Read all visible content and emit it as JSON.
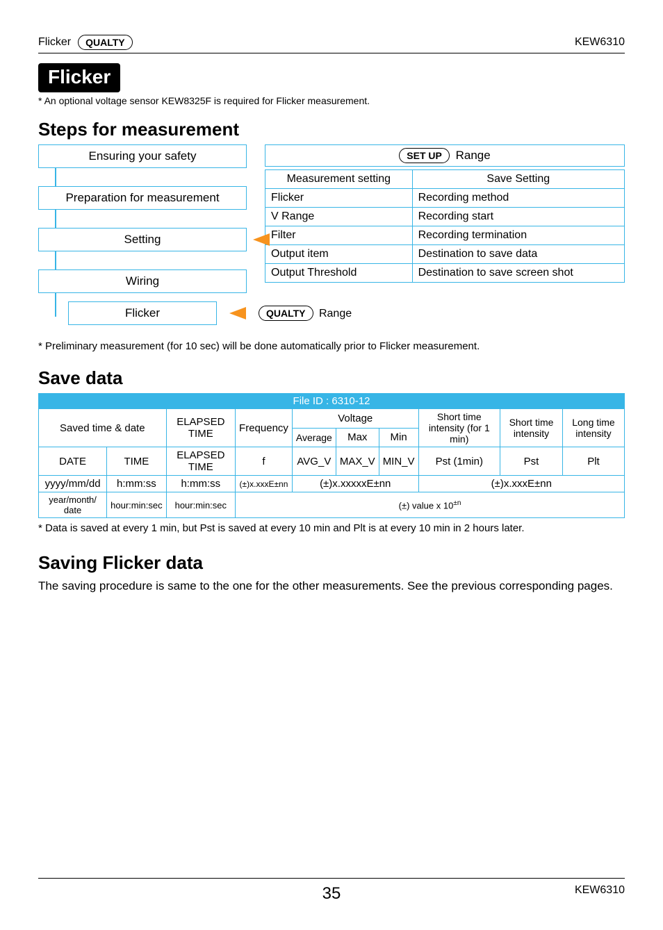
{
  "header": {
    "left_label": "Flicker",
    "left_pill": "QUALTY",
    "right_label": "KEW6310"
  },
  "flicker_chip": "Flicker",
  "sensor_note": "* An optional voltage sensor KEW8325F is required for Flicker measurement.",
  "steps_heading": "Steps for measurement",
  "steps": {
    "s1": "Ensuring your safety",
    "s2": "Preparation for measurement",
    "s3": "Setting",
    "s4": "Wiring",
    "s5": "Flicker"
  },
  "range": {
    "pill": "SET UP",
    "range_text": "Range",
    "col1_head": "Measurement setting",
    "col2_head": "Save Setting",
    "rows": [
      {
        "l": "Flicker",
        "r": "Recording method"
      },
      {
        "l": "V Range",
        "r": "Recording start"
      },
      {
        "l": "Filter",
        "r": "Recording termination"
      },
      {
        "l": "Output item",
        "r": "Destination to save data"
      },
      {
        "l": "Output Threshold",
        "r": "Destination to save screen shot"
      }
    ]
  },
  "qualty_pill": "QUALTY",
  "qualty_range": "Range",
  "prelim_note": "* Preliminary measurement (for 10 sec) will be done automatically prior to Flicker measurement.",
  "save_heading": "Save data",
  "save": {
    "file_id": "File ID : 6310-12",
    "saved_time_date": "Saved time & date",
    "elapsed_time": "ELAPSED TIME",
    "frequency": "Frequency",
    "voltage": "Voltage",
    "average": "Average",
    "max": "Max",
    "min": "Min",
    "short_time_intensity_1min": "Short time intensity (for 1 min)",
    "short_time_intensity": "Short time intensity",
    "long_time_intensity": "Long time intensity",
    "date": "DATE",
    "time": "TIME",
    "f": "f",
    "avg_v": "AVG_V",
    "max_v": "MAX_V",
    "min_v": "MIN_V",
    "pst_1min": "Pst (1min)",
    "pst": "Pst",
    "plt": "Plt",
    "yyyy": "yyyy/mm/dd",
    "hmmss": "h:mm:ss",
    "fmt1": "(±)x.xxxE±nn",
    "fmt2": "(±)x.xxxxxE±nn",
    "fmt3": "(±)x.xxxE±nn",
    "ymd": "year/month/ date",
    "hms": "hour:min:sec",
    "val_base": "(±) value x 10",
    "val_sup": "±n"
  },
  "save_note": "* Data is saved at every 1 min, but Pst is saved at every 10 min and Plt is at every 10 min in 2 hours later.",
  "saving_heading": "Saving Flicker data",
  "saving_text": "The saving procedure is same to the one for the other measurements. See the previous corresponding pages.",
  "footer": {
    "page": "35",
    "right": "KEW6310"
  }
}
